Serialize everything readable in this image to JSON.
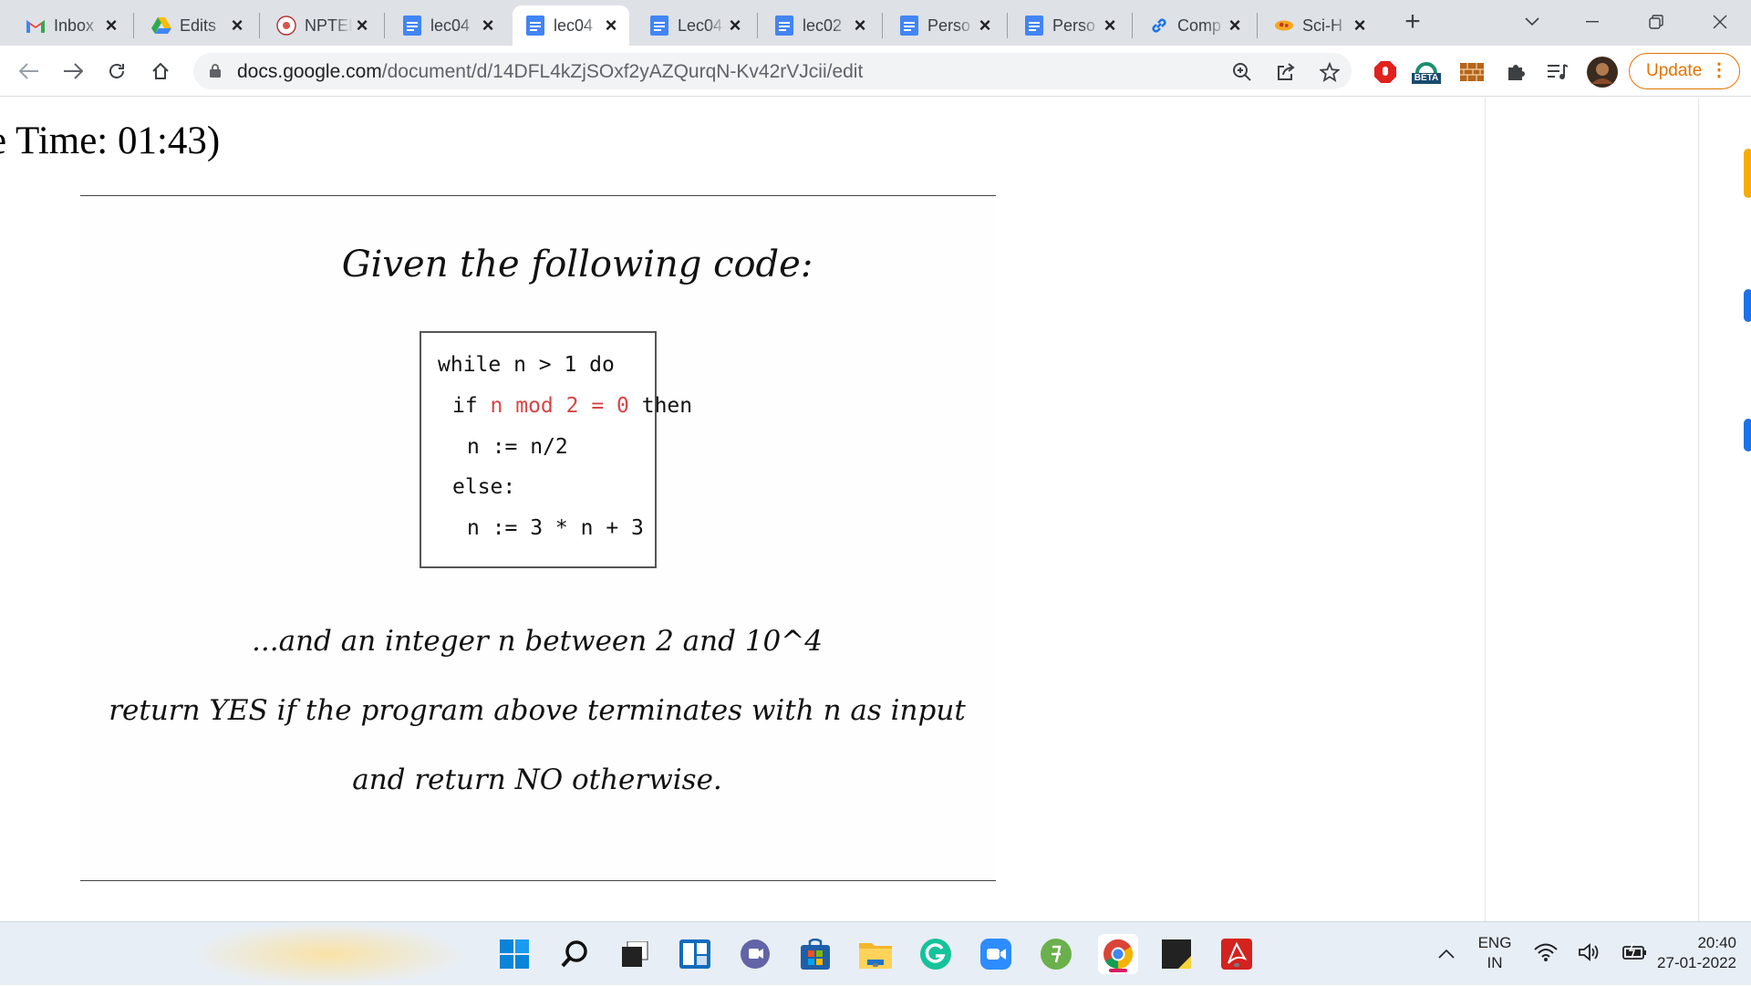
{
  "browser": {
    "tabs": [
      {
        "title": "Inbox",
        "icon": "gmail-icon",
        "active": false
      },
      {
        "title": "Edits",
        "icon": "google-drive-icon",
        "active": false
      },
      {
        "title": "NPTEL",
        "icon": "nptel-icon",
        "active": false
      },
      {
        "title": "lec04",
        "icon": "google-docs-icon",
        "active": false
      },
      {
        "title": "lec04",
        "icon": "google-docs-icon",
        "active": true
      },
      {
        "title": "Lec04",
        "icon": "google-docs-icon",
        "active": false
      },
      {
        "title": "lec02",
        "icon": "google-docs-icon",
        "active": false
      },
      {
        "title": "Perso",
        "icon": "google-docs-icon",
        "active": false
      },
      {
        "title": "Perso",
        "icon": "google-docs-icon",
        "active": false
      },
      {
        "title": "Comp",
        "icon": "link-icon",
        "active": false
      },
      {
        "title": "Sci-H",
        "icon": "sci-hub-icon",
        "active": false
      }
    ],
    "url_host": "docs.google.com",
    "url_path": "/document/d/14DFL4kZjSOxf2yAZQurqN-Kv42rVJcii/edit",
    "update_label": "Update",
    "beta_badge": "BETA"
  },
  "document": {
    "heading": "e Time: 01:43)",
    "slide": {
      "title": "Given the following code:",
      "code": [
        {
          "parts": [
            {
              "text": "while n > 1 do",
              "color": "#111111"
            }
          ]
        },
        {
          "parts": [
            {
              "text": "if ",
              "color": "#111111"
            },
            {
              "text": "n mod 2 = 0",
              "color": "#d64545"
            },
            {
              "text": " then",
              "color": "#111111"
            }
          ]
        },
        {
          "parts": [
            {
              "text": "n := n/2",
              "color": "#111111"
            }
          ]
        },
        {
          "parts": [
            {
              "text": "else:",
              "color": "#111111"
            }
          ]
        },
        {
          "parts": [
            {
              "text": "n := 3 * n + 3",
              "color": "#111111"
            }
          ]
        }
      ],
      "line1": "...and an integer n between 2 and 10^4",
      "line2": "return YES if the program above terminates with n as input",
      "line3": "and return NO otherwise."
    }
  },
  "taskbar": {
    "apps": [
      "windows-start-icon",
      "search-icon",
      "task-view-icon",
      "widgets-icon",
      "teams-chat-icon",
      "microsoft-store-icon",
      "file-explorer-icon",
      "grammarly-icon",
      "zoom-icon",
      "app-icon",
      "chrome-icon",
      "sticky-notes-icon",
      "acrobat-icon"
    ],
    "language": "ENG",
    "region": "IN",
    "time": "20:40",
    "date": "27-01-2022"
  },
  "colors": {
    "accent_chrome": "#4285f4",
    "update_orange": "#e37400",
    "code_red": "#d64545"
  }
}
